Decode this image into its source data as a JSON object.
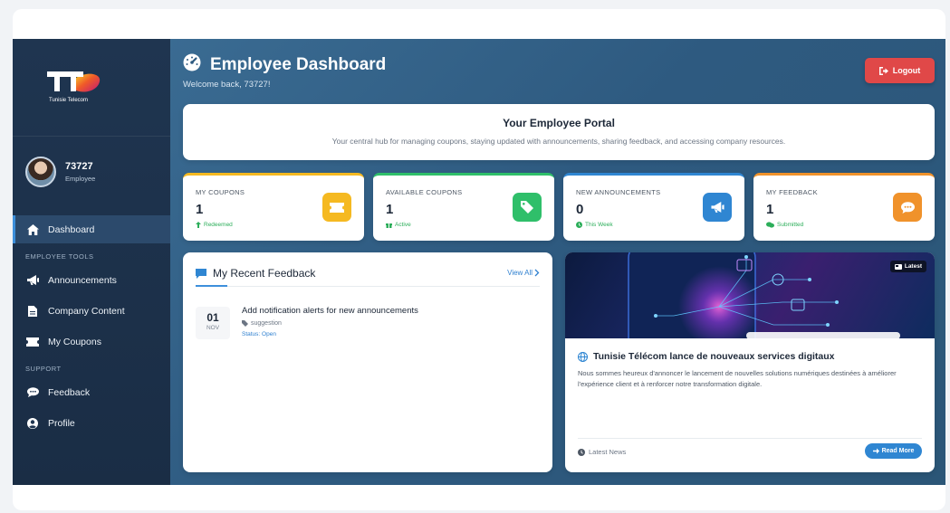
{
  "brand": {
    "logo_text": "Tunisie Telecom"
  },
  "user": {
    "name": "73727",
    "role": "Employee"
  },
  "sidebar": {
    "active": {
      "label": "Dashboard",
      "icon": "home-icon"
    },
    "sections": [
      {
        "title": "EMPLOYEE TOOLS",
        "items": [
          {
            "label": "Announcements",
            "icon": "megaphone-icon"
          },
          {
            "label": "Company Content",
            "icon": "file-icon"
          },
          {
            "label": "My Coupons",
            "icon": "ticket-icon"
          }
        ]
      },
      {
        "title": "SUPPORT",
        "items": [
          {
            "label": "Feedback",
            "icon": "comments-icon"
          },
          {
            "label": "Profile",
            "icon": "user-circle-icon"
          }
        ]
      }
    ]
  },
  "header": {
    "title": "Employee Dashboard",
    "subtitle": "Welcome back, 73727!",
    "logout_label": "Logout"
  },
  "portal": {
    "title": "Your Employee Portal",
    "subtitle": "Your central hub for managing coupons, staying updated with announcements, sharing feedback, and accessing company resources."
  },
  "stats": [
    {
      "label": "MY COUPONS",
      "value": "1",
      "note": "Redeemed",
      "accent": "#f5b921",
      "icon": "ticket-icon"
    },
    {
      "label": "AVAILABLE COUPONS",
      "value": "1",
      "note": "Active",
      "accent": "#2fbf6a",
      "icon": "tag-icon"
    },
    {
      "label": "NEW ANNOUNCEMENTS",
      "value": "0",
      "note": "This Week",
      "accent": "#2f86d2",
      "icon": "megaphone-icon"
    },
    {
      "label": "MY FEEDBACK",
      "value": "1",
      "note": "Submitted",
      "accent": "#f0922b",
      "icon": "comment-icon"
    }
  ],
  "feedback": {
    "title": "My Recent Feedback",
    "view_all": "View All",
    "items": [
      {
        "day": "01",
        "month": "NOV",
        "title": "Add notification alerts for new announcements",
        "category": "suggestion",
        "status": "Status: Open"
      }
    ]
  },
  "news": {
    "badge": "Latest",
    "title": "Tunisie Télécom lance de nouveaux services digitaux",
    "text": "Nous sommes heureux d'annoncer le lancement de nouvelles solutions numériques destinées à améliorer l'expérience client et à renforcer notre transformation digitale.",
    "footer": "Latest News",
    "read_more": "Read More"
  },
  "colors": {
    "sidebar": "#1f3550",
    "main": "#3a6b92",
    "logout": "#e04848",
    "link": "#2f80d0"
  }
}
